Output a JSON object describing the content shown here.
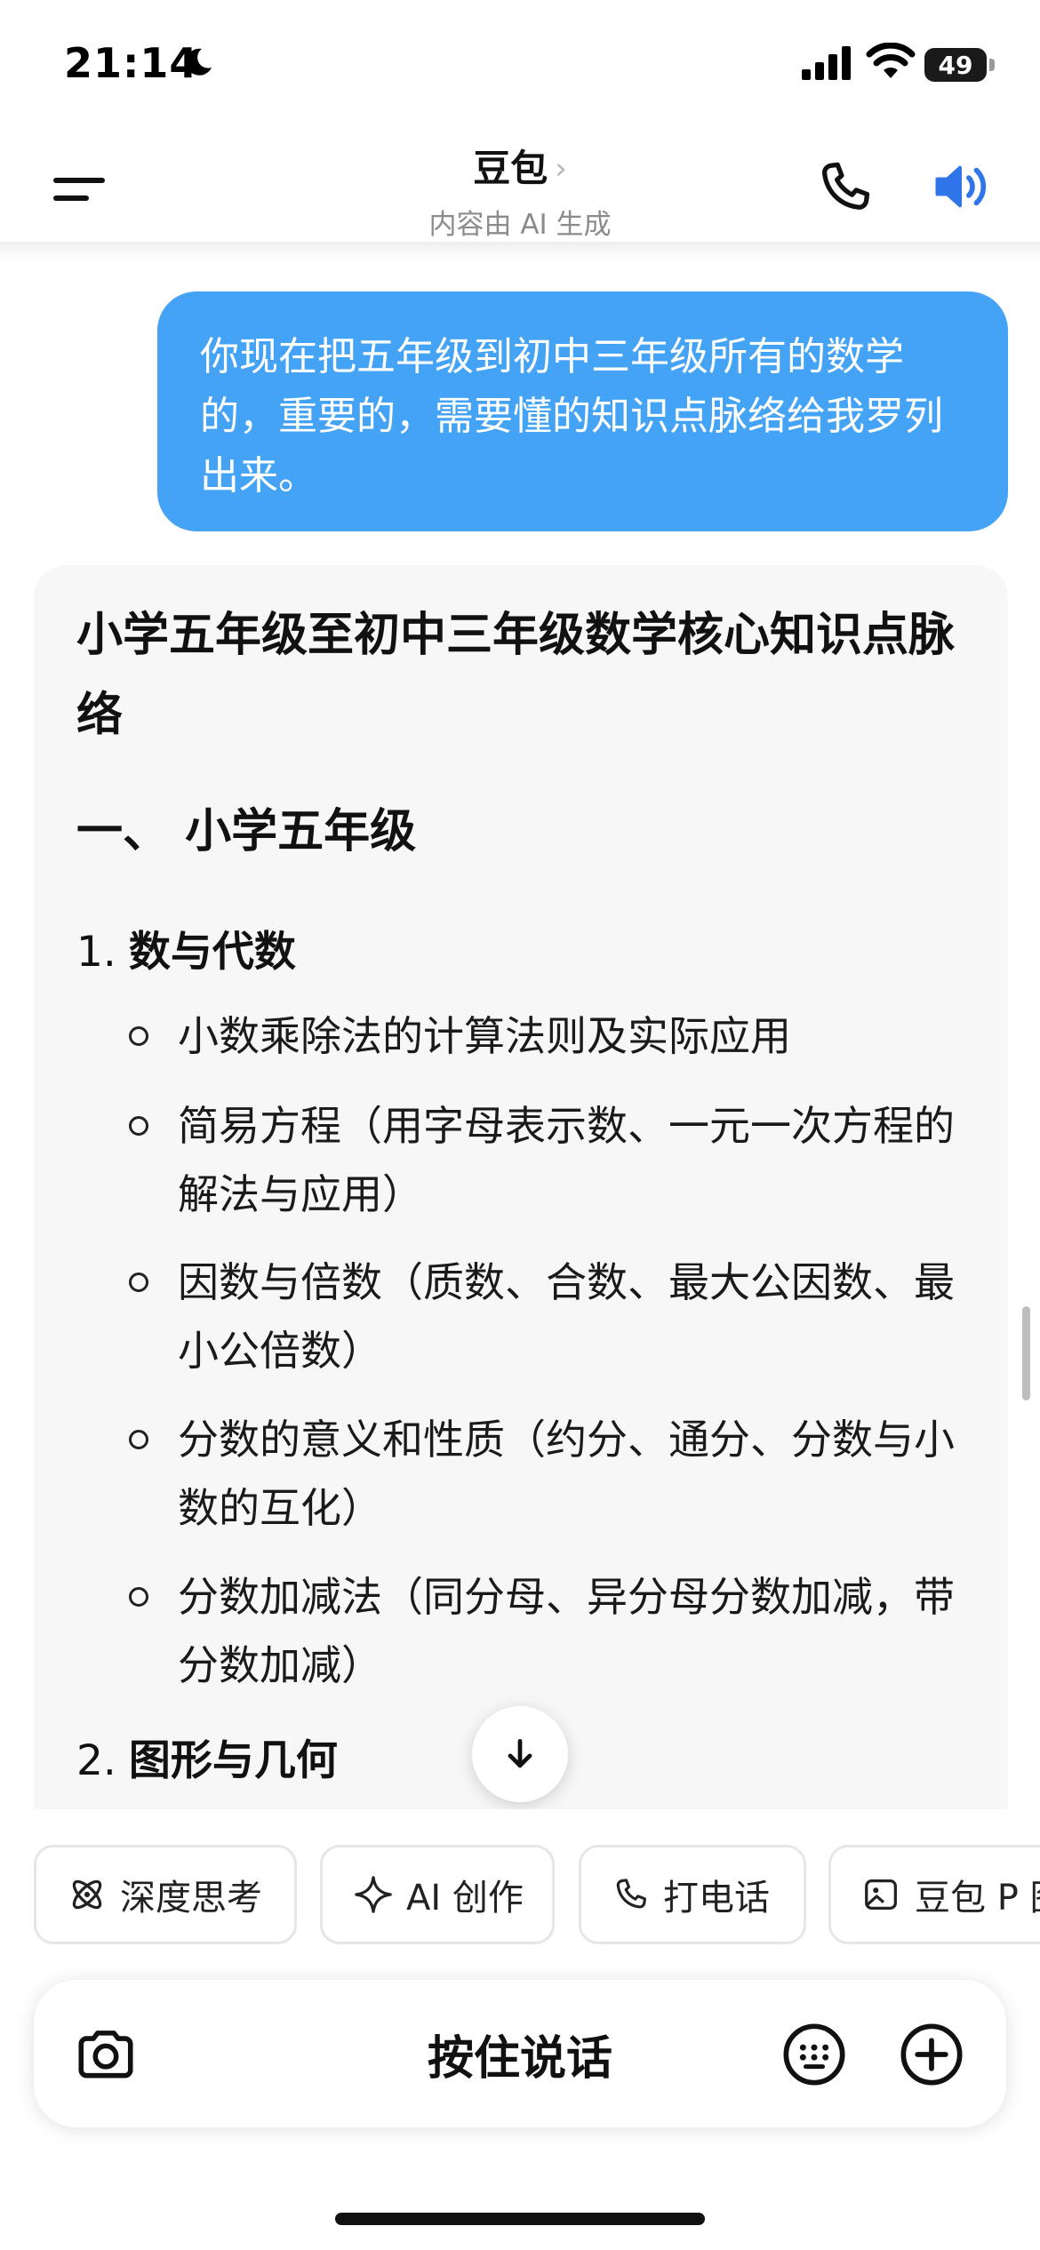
{
  "status_bar": {
    "time": "21:14",
    "battery": "49"
  },
  "header": {
    "title": "豆包",
    "chevron": "›",
    "subtitle": "内容由 AI 生成"
  },
  "user_message": {
    "text": "你现在把五年级到初中三年级所有的数学的，重要的，需要懂的知识点脉络给我罗列出来。"
  },
  "response": {
    "title": "小学五年级至初中三年级数学核心知识点脉络",
    "section1": "一、 小学五年级",
    "subsection1": {
      "num": "1.",
      "label": "数与代数"
    },
    "items": [
      "小数乘除法的计算法则及实际应用",
      "简易方程（用字母表示数、一元一次方程的解法与应用）",
      "因数与倍数（质数、合数、最大公因数、最小公倍数）",
      "分数的意义和性质（约分、通分、分数与小数的互化）",
      "分数加减法（同分母、异分母分数加减，带分数加减）"
    ],
    "subsection2": {
      "num": "2.",
      "label": "图形与几何"
    }
  },
  "chips": [
    "深度思考",
    "AI 创作",
    "打电话",
    "豆包 P 图"
  ],
  "input": {
    "hold_to_talk": "按住说话"
  },
  "colors": {
    "accent": "#45a3f5",
    "speaker": "#2f74e8"
  }
}
